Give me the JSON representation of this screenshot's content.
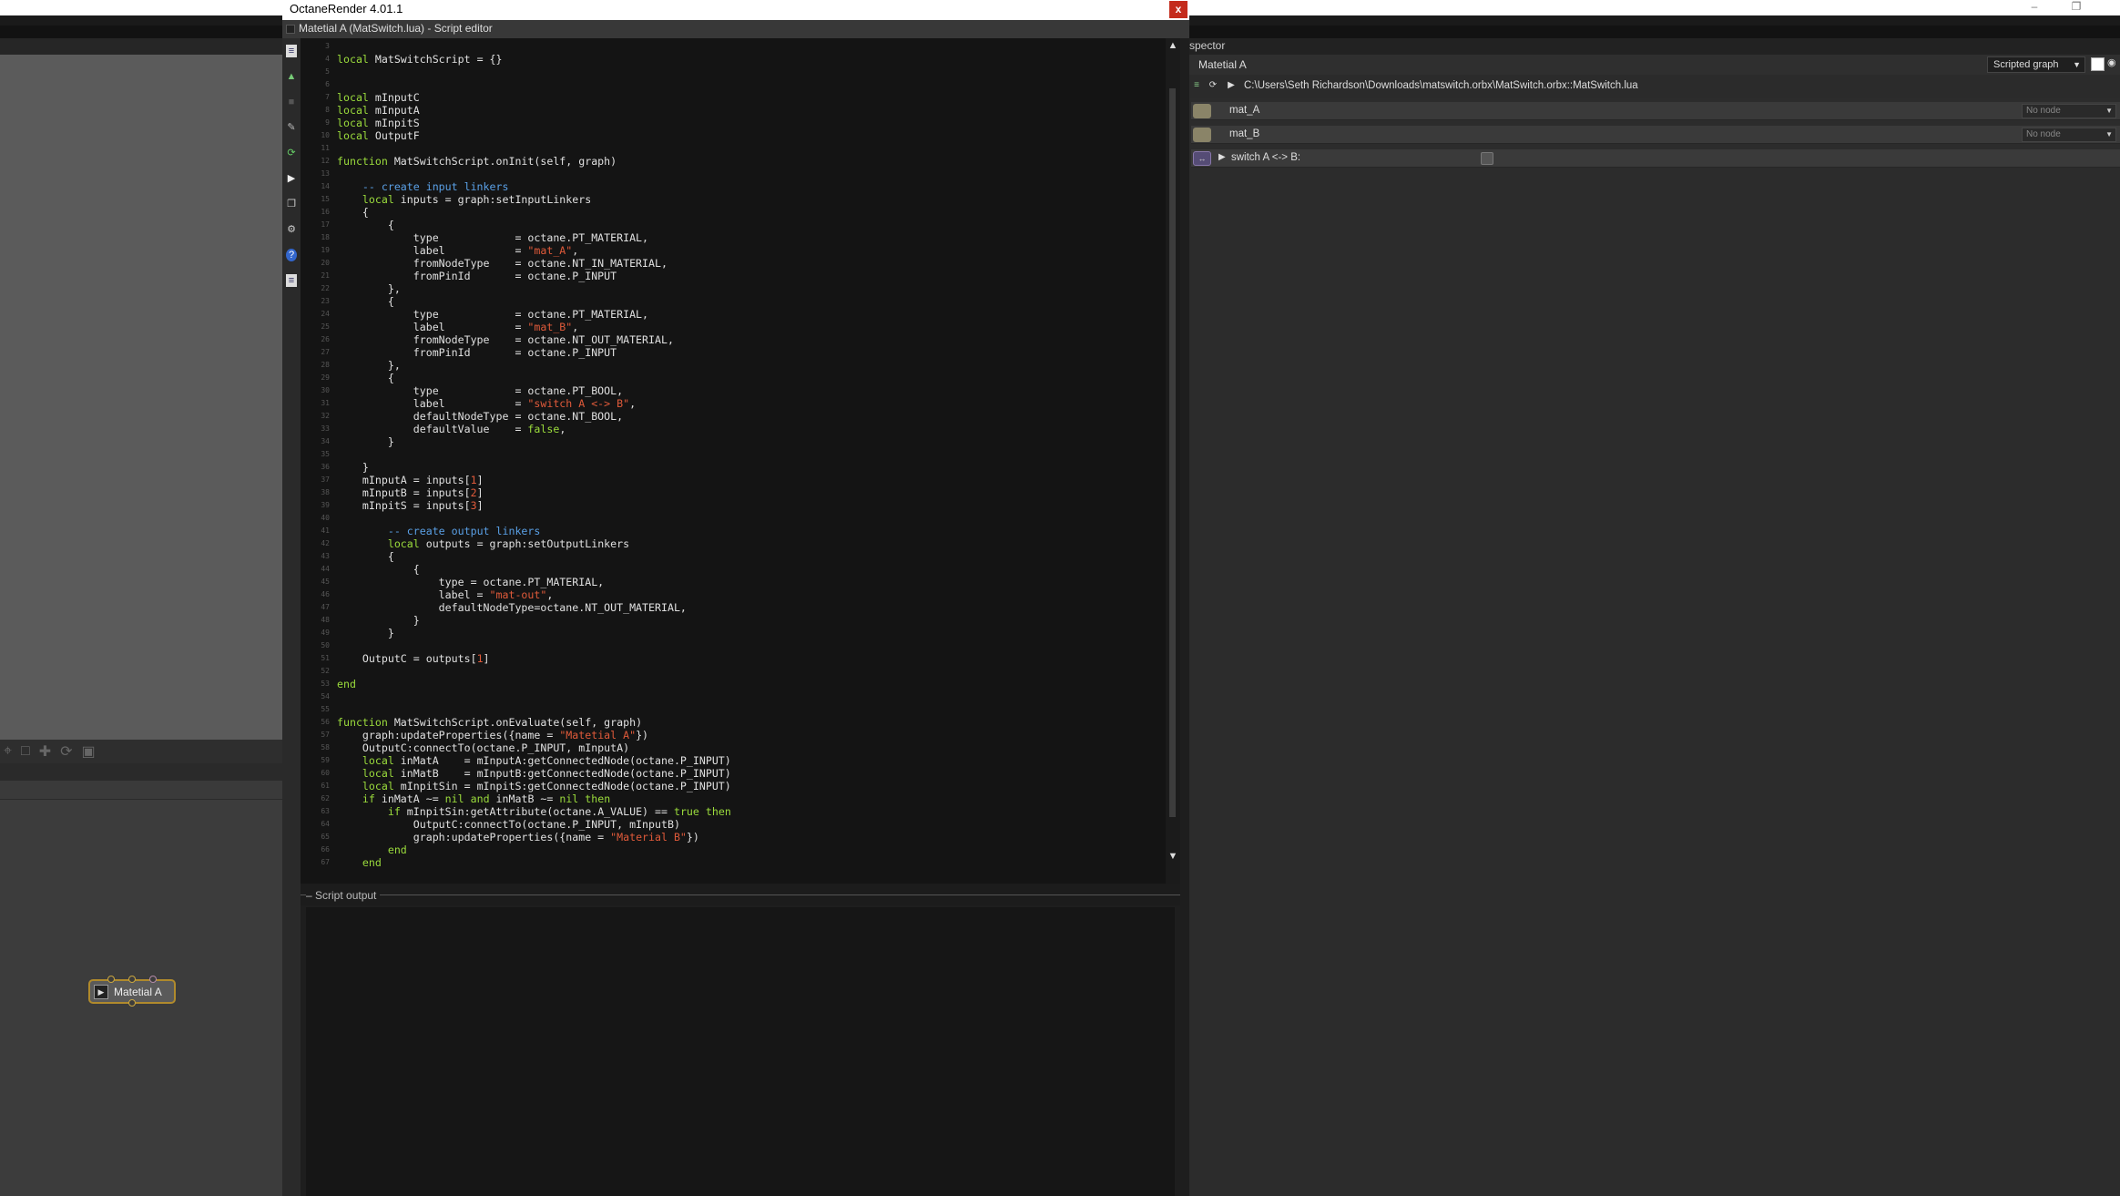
{
  "app": {
    "title": "OctaneRender 4.01.1"
  },
  "editor": {
    "subtitle": "Matetial A (MatSwitch.lua) - Script editor",
    "close_label": "x",
    "output_label": "Script output",
    "code_lines": [
      {
        "n": "3",
        "t": ""
      },
      {
        "n": "4",
        "t": "local MatSwitchScript = {}"
      },
      {
        "n": "5",
        "t": ""
      },
      {
        "n": "6",
        "t": ""
      },
      {
        "n": "7",
        "t": "local mInputC"
      },
      {
        "n": "8",
        "t": "local mInputA"
      },
      {
        "n": "9",
        "t": "local mInpitS"
      },
      {
        "n": "10",
        "t": "local OutputF"
      },
      {
        "n": "11",
        "t": ""
      },
      {
        "n": "12",
        "t": "function MatSwitchScript.onInit(self, graph)"
      },
      {
        "n": "13",
        "t": ""
      },
      {
        "n": "14",
        "t": "    -- create input linkers"
      },
      {
        "n": "15",
        "t": "    local inputs = graph:setInputLinkers"
      },
      {
        "n": "16",
        "t": "    {"
      },
      {
        "n": "17",
        "t": "        {"
      },
      {
        "n": "18",
        "t": "            type            = octane.PT_MATERIAL,"
      },
      {
        "n": "19",
        "t": "            label           = \"mat_A\","
      },
      {
        "n": "20",
        "t": "            fromNodeType    = octane.NT_IN_MATERIAL,"
      },
      {
        "n": "21",
        "t": "            fromPinId       = octane.P_INPUT"
      },
      {
        "n": "22",
        "t": "        },"
      },
      {
        "n": "23",
        "t": "        {"
      },
      {
        "n": "24",
        "t": "            type            = octane.PT_MATERIAL,"
      },
      {
        "n": "25",
        "t": "            label           = \"mat_B\","
      },
      {
        "n": "26",
        "t": "            fromNodeType    = octane.NT_OUT_MATERIAL,"
      },
      {
        "n": "27",
        "t": "            fromPinId       = octane.P_INPUT"
      },
      {
        "n": "28",
        "t": "        },"
      },
      {
        "n": "29",
        "t": "        {"
      },
      {
        "n": "30",
        "t": "            type            = octane.PT_BOOL,"
      },
      {
        "n": "31",
        "t": "            label           = \"switch A <-> B\","
      },
      {
        "n": "32",
        "t": "            defaultNodeType = octane.NT_BOOL,"
      },
      {
        "n": "33",
        "t": "            defaultValue    = false,"
      },
      {
        "n": "34",
        "t": "        }"
      },
      {
        "n": "35",
        "t": ""
      },
      {
        "n": "36",
        "t": "    }"
      },
      {
        "n": "37",
        "t": "    mInputA = inputs[1]"
      },
      {
        "n": "38",
        "t": "    mInputB = inputs[2]"
      },
      {
        "n": "39",
        "t": "    mInpitS = inputs[3]"
      },
      {
        "n": "40",
        "t": ""
      },
      {
        "n": "41",
        "t": "        -- create output linkers"
      },
      {
        "n": "42",
        "t": "        local outputs = graph:setOutputLinkers"
      },
      {
        "n": "43",
        "t": "        {"
      },
      {
        "n": "44",
        "t": "            {"
      },
      {
        "n": "45",
        "t": "                type = octane.PT_MATERIAL,"
      },
      {
        "n": "46",
        "t": "                label = \"mat-out\","
      },
      {
        "n": "47",
        "t": "                defaultNodeType=octane.NT_OUT_MATERIAL,"
      },
      {
        "n": "48",
        "t": "            }"
      },
      {
        "n": "49",
        "t": "        }"
      },
      {
        "n": "50",
        "t": ""
      },
      {
        "n": "51",
        "t": "    OutputC = outputs[1]"
      },
      {
        "n": "52",
        "t": ""
      },
      {
        "n": "53",
        "t": "end"
      },
      {
        "n": "54",
        "t": ""
      },
      {
        "n": "55",
        "t": ""
      },
      {
        "n": "56",
        "t": "function MatSwitchScript.onEvaluate(self, graph)"
      },
      {
        "n": "57",
        "t": "    graph:updateProperties({name = \"Matetial A\"})"
      },
      {
        "n": "58",
        "t": "    OutputC:connectTo(octane.P_INPUT, mInputA)"
      },
      {
        "n": "59",
        "t": "    local inMatA    = mInputA:getConnectedNode(octane.P_INPUT)"
      },
      {
        "n": "60",
        "t": "    local inMatB    = mInputB:getConnectedNode(octane.P_INPUT)"
      },
      {
        "n": "61",
        "t": "    local mInpitSin = mInpitS:getConnectedNode(octane.P_INPUT)"
      },
      {
        "n": "62",
        "t": "    if inMatA ~= nil and inMatB ~= nil then"
      },
      {
        "n": "63",
        "t": "        if mInpitSin:getAttribute(octane.A_VALUE) == true then"
      },
      {
        "n": "64",
        "t": "            OutputC:connectTo(octane.P_INPUT, mInputB)"
      },
      {
        "n": "65",
        "t": "            graph:updateProperties({name = \"Material B\"})"
      },
      {
        "n": "66",
        "t": "        end"
      },
      {
        "n": "67",
        "t": "    end"
      }
    ]
  },
  "graph": {
    "node_label": "Matetial A"
  },
  "inspector": {
    "title": "spector",
    "node_name": "Matetial A",
    "graph_type": "Scripted graph",
    "script_path": "C:\\Users\\Seth Richardson\\Downloads\\matswitch.orbx\\MatSwitch.orbx::MatSwitch.lua",
    "pins": [
      {
        "label": "mat_A",
        "value": "No node"
      },
      {
        "label": "mat_B",
        "value": "No node"
      }
    ],
    "bool_pin": {
      "label": "switch A <-> B:"
    }
  },
  "colors": {
    "keyword": "#9bdc3c",
    "string": "#e05a3a",
    "comment": "#5aa0e6",
    "node_border": "#b08a2c"
  }
}
